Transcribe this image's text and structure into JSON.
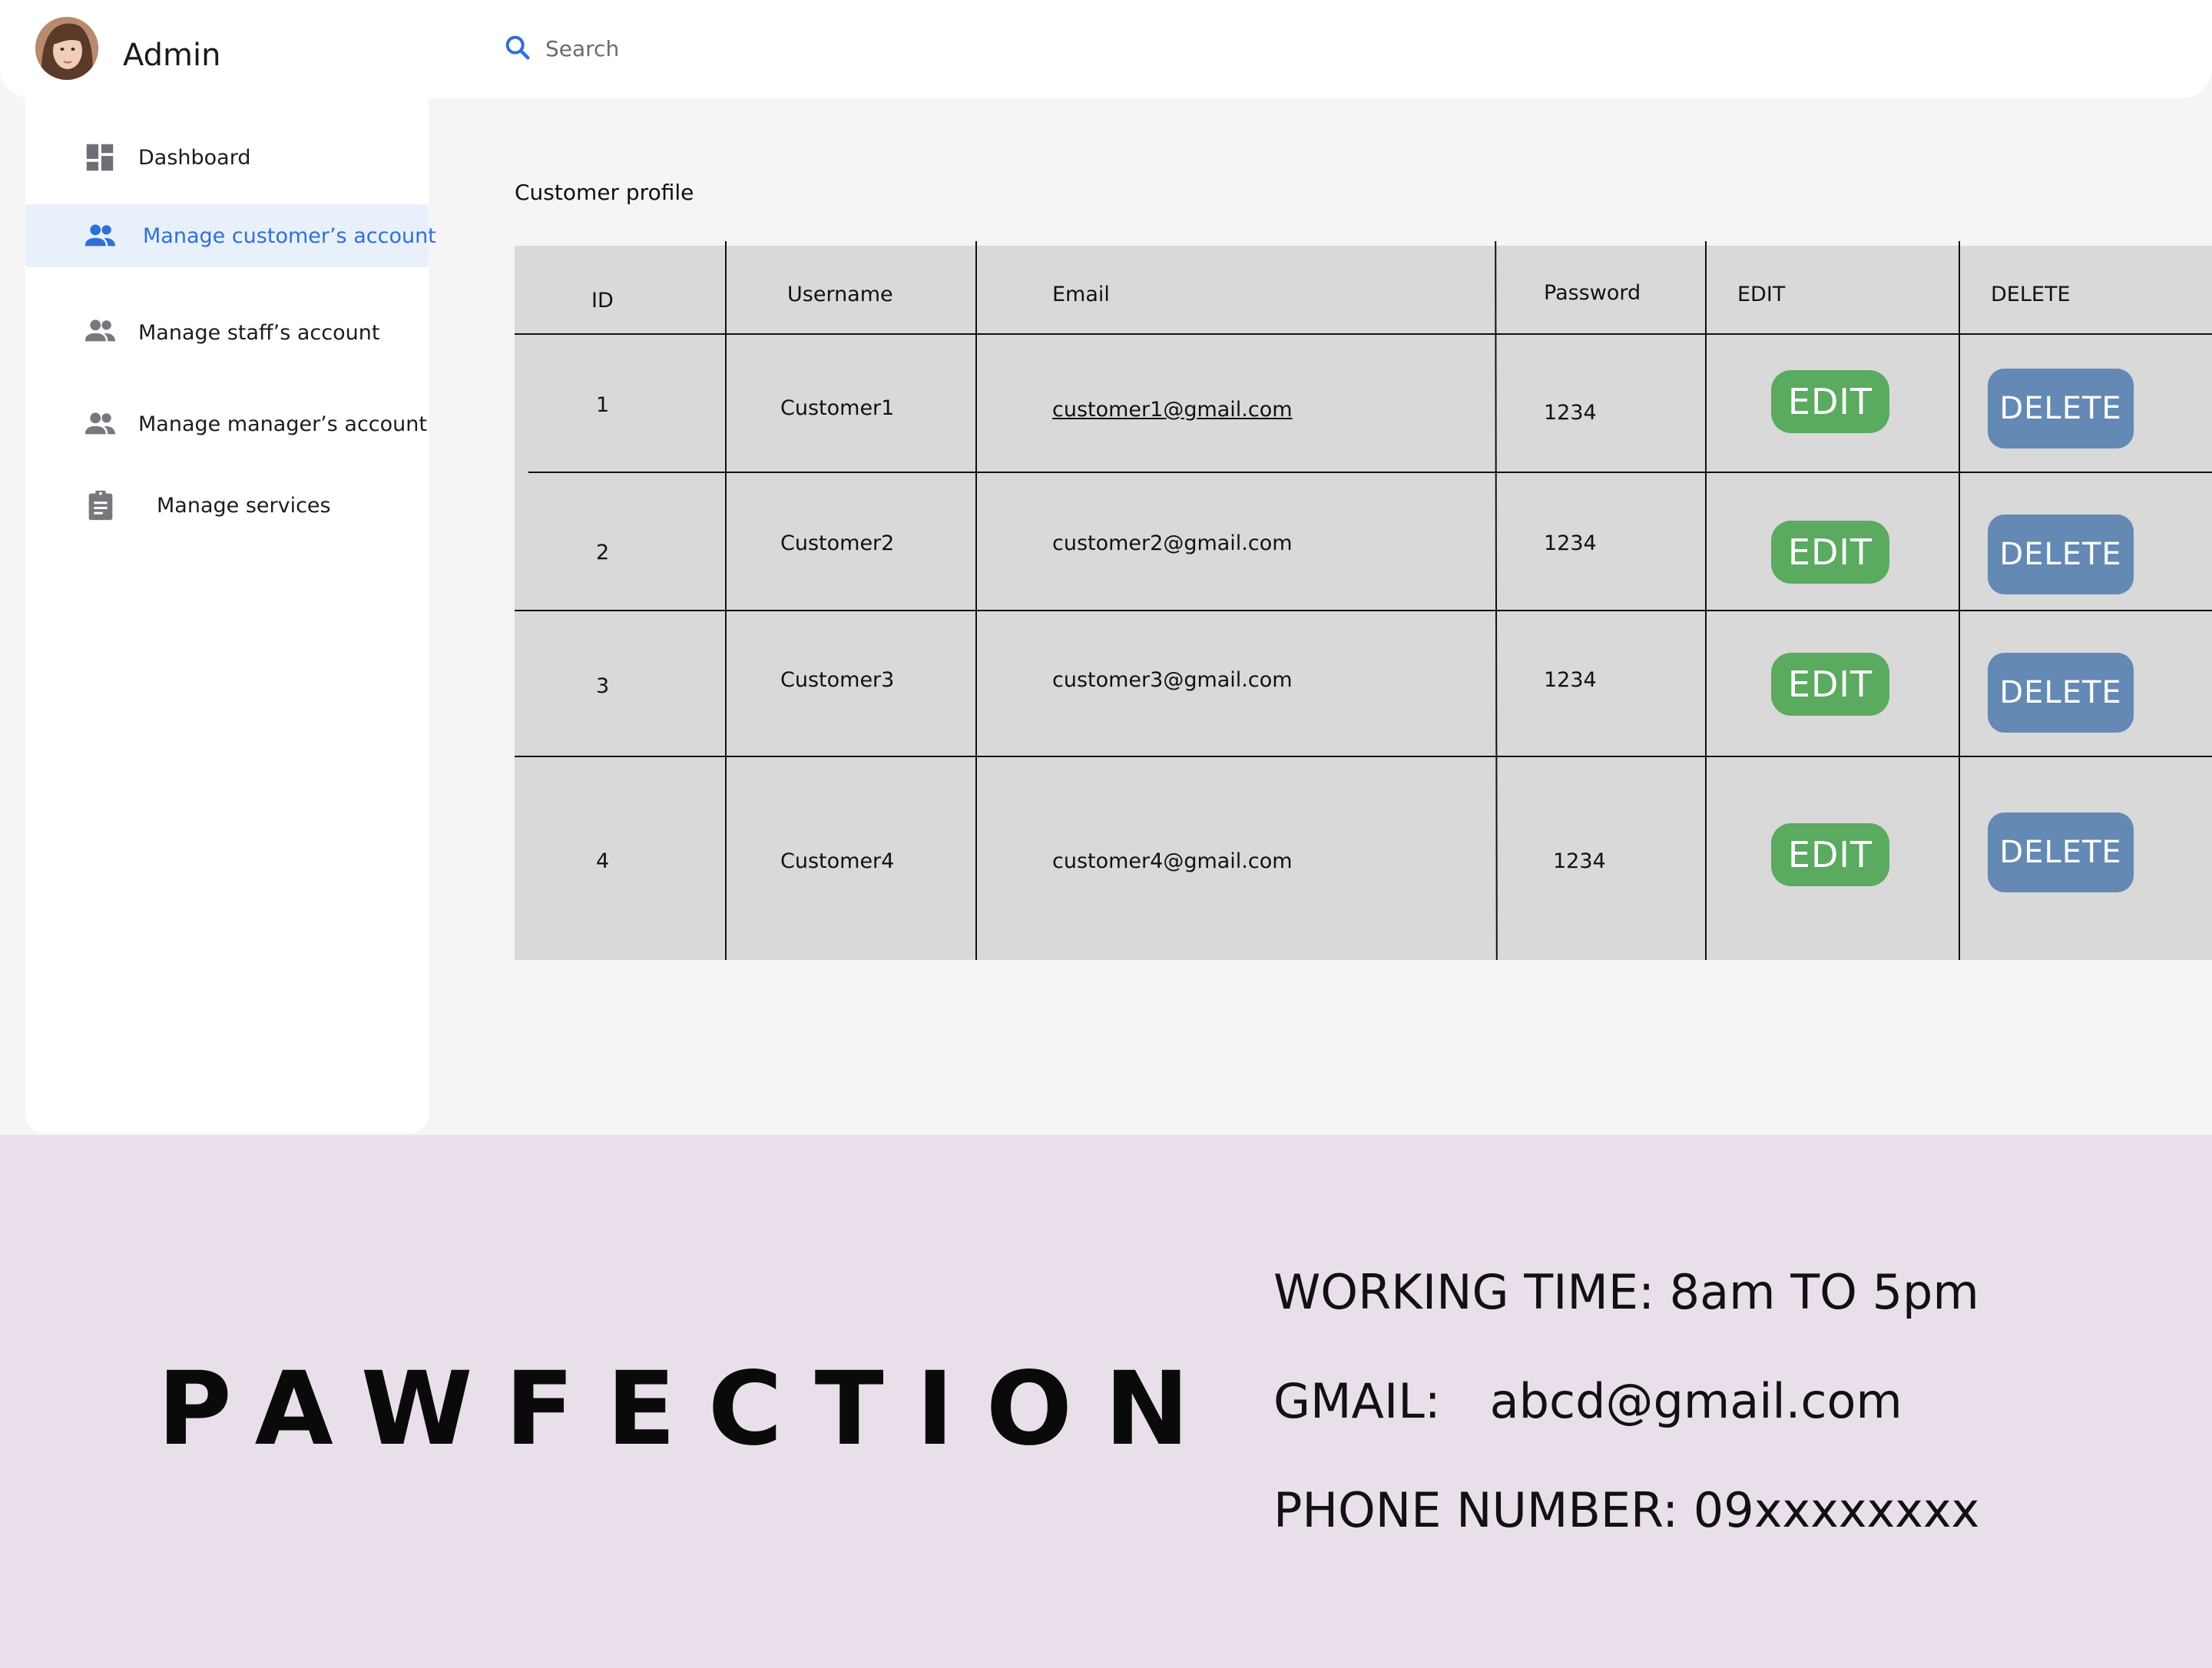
{
  "header": {
    "user_name": "Admin",
    "search_placeholder": "Search"
  },
  "sidebar": {
    "items": [
      {
        "label": "Dashboard",
        "icon": "dashboard-icon",
        "active": false
      },
      {
        "label": "Manage customer’s account",
        "icon": "people-icon",
        "active": true
      },
      {
        "label": "Manage staff’s account",
        "icon": "people-icon",
        "active": false
      },
      {
        "label": "Manage manager’s account",
        "icon": "people-icon",
        "active": false
      },
      {
        "label": "Manage services",
        "icon": "clipboard-icon",
        "active": false
      }
    ]
  },
  "main": {
    "title": "Customer profile",
    "table": {
      "columns": [
        "ID",
        "Username",
        "Email",
        "Password",
        "EDIT",
        "DELETE"
      ],
      "rows": [
        {
          "id": "1",
          "username": "Customer1",
          "email": "customer1@gmail.com",
          "password": "1234",
          "edit": "EDIT",
          "delete": "DELETE"
        },
        {
          "id": "2",
          "username": "Customer2",
          "email": "customer2@gmail.com",
          "password": "1234",
          "edit": "EDIT",
          "delete": "DELETE"
        },
        {
          "id": "3",
          "username": "Customer3",
          "email": "customer3@gmail.com",
          "password": "1234",
          "edit": "EDIT",
          "delete": "DELETE"
        },
        {
          "id": "4",
          "username": "Customer4",
          "email": "customer4@gmail.com",
          "password": "1234",
          "edit": "EDIT",
          "delete": "DELETE"
        }
      ]
    }
  },
  "footer": {
    "brand": "PAWFECTION",
    "working_time": "WORKING TIME: 8am TO  5pm",
    "gmail_label": "GMAIL:",
    "gmail_value": "abcd@gmail.com",
    "phone": "PHONE NUMBER: 09xxxxxxxx"
  },
  "colors": {
    "accent": "#2f6fd8",
    "edit_button": "#5aaa60",
    "delete_button": "#6389b4",
    "footer_bg": "#e9dfea",
    "table_bg": "#d9d9d9"
  }
}
